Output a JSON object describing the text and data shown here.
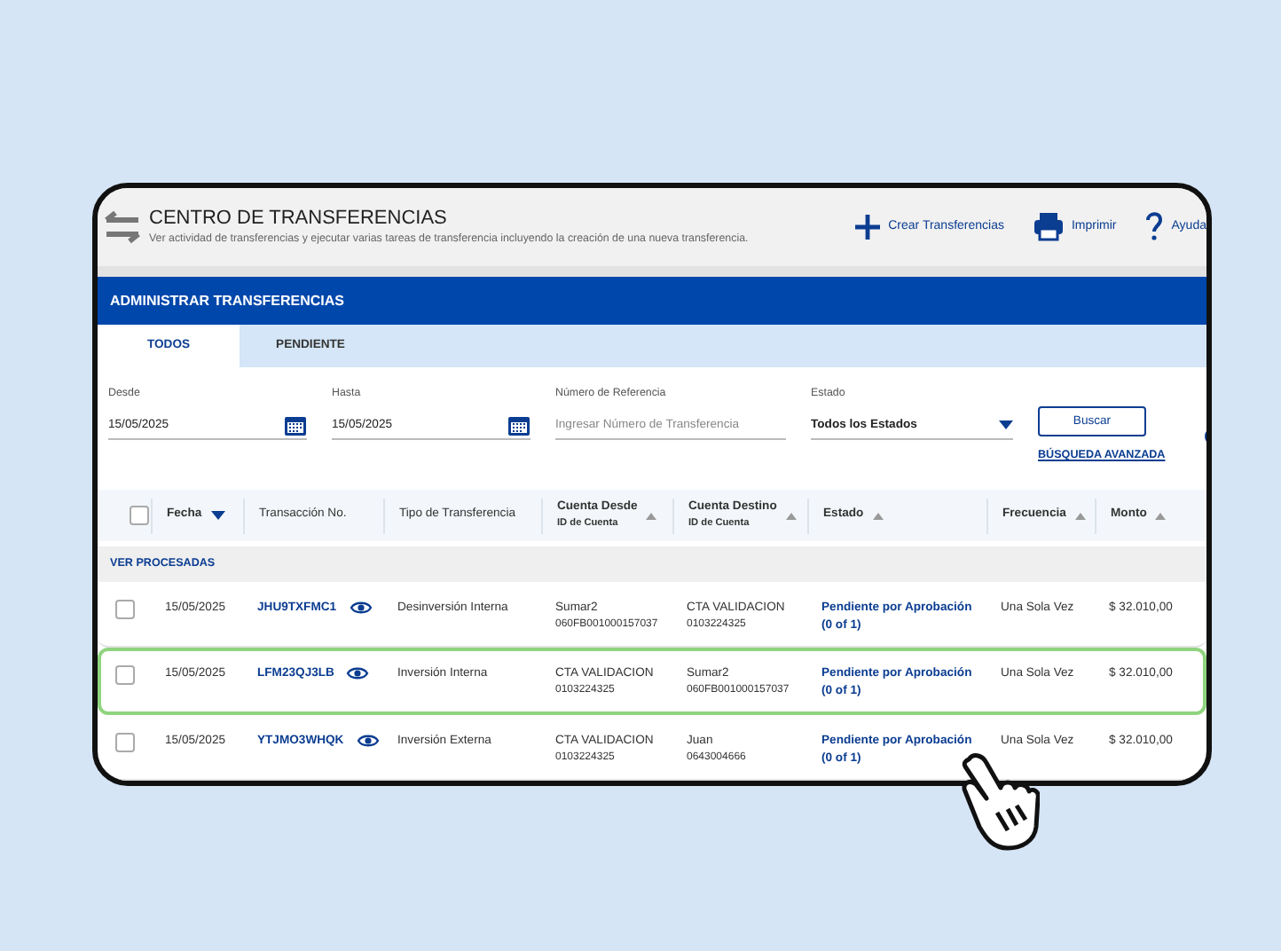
{
  "header": {
    "title": "CENTRO DE TRANSFERENCIAS",
    "subtitle": "Ver actividad de transferencias y ejecutar varias tareas de transferencia incluyendo la creación de una nueva transferencia.",
    "actions": [
      {
        "kind": "plus",
        "label": "Crear Transferencias"
      },
      {
        "kind": "print",
        "label": "Imprimir"
      },
      {
        "kind": "help",
        "label": "Ayuda"
      }
    ]
  },
  "section_title": "ADMINISTRAR TRANSFERENCIAS",
  "tabs": [
    {
      "label": "TODOS",
      "selected": true
    },
    {
      "label": "PENDIENTE",
      "selected": false
    }
  ],
  "filters": [
    {
      "kind": "date",
      "label": "Desde",
      "value": "15/05/2025"
    },
    {
      "kind": "date",
      "label": "Hasta",
      "value": "15/05/2025"
    },
    {
      "kind": "text",
      "label": "Número de Referencia",
      "placeholder": "Ingresar Número de Transferencia"
    },
    {
      "kind": "select",
      "label": "Estado",
      "value": "Todos los Estados"
    }
  ],
  "search_button": "Buscar",
  "advanced_search": "BÚSQUEDA AVANZADA",
  "table": {
    "select_all_checked": false,
    "columns": [
      {
        "label": "Fecha",
        "sortable": true,
        "sorted": true
      },
      {
        "label": "Transacción No.",
        "sortable": false
      },
      {
        "label": "Tipo de Transferencia",
        "sortable": false
      },
      {
        "label": "Cuenta Desde",
        "sublabel": "ID de Cuenta",
        "sortable": true,
        "sorted": false
      },
      {
        "label": "Cuenta Destino",
        "sublabel": "ID de Cuenta",
        "sortable": true,
        "sorted": false
      },
      {
        "label": "Estado",
        "sortable": true,
        "sorted": false
      },
      {
        "label": "Frecuencia",
        "sortable": true,
        "sorted": false
      },
      {
        "label": "Monto",
        "sortable": true,
        "sorted": false
      }
    ],
    "group_label": "VER PROCESADAS",
    "rows": [
      {
        "checked": false,
        "selected": false,
        "date": "15/05/2025",
        "transaction": "JHU9TXFMC1",
        "type": "Desinversión Interna",
        "from_name": "Sumar2",
        "from_id": "060FB001000157037",
        "to_name": "CTA VALIDACION",
        "to_id": "0103224325",
        "status": "Pendiente por Aprobación",
        "status_count": "(0 of 1)",
        "frequency": "Una Sola Vez",
        "amount": "$ 32.010,00"
      },
      {
        "checked": false,
        "selected": true,
        "date": "15/05/2025",
        "transaction": "LFM23QJ3LB",
        "type": "Inversión Interna",
        "from_name": "CTA VALIDACION",
        "from_id": "0103224325",
        "to_name": "Sumar2",
        "to_id": "060FB001000157037",
        "status": "Pendiente por Aprobación",
        "status_count": "(0 of 1)",
        "frequency": "Una Sola Vez",
        "amount": "$ 32.010,00"
      },
      {
        "checked": false,
        "selected": false,
        "date": "15/05/2025",
        "transaction": "YTJMO3WHQK",
        "type": "Inversión Externa",
        "from_name": "CTA VALIDACION",
        "from_id": "0103224325",
        "to_name": "Juan",
        "to_id": "0643004666",
        "status": "Pendiente por Aprobación",
        "status_count": "(0 of 1)",
        "frequency": "Una Sola Vez",
        "amount": "$ 32.010,00"
      }
    ]
  }
}
